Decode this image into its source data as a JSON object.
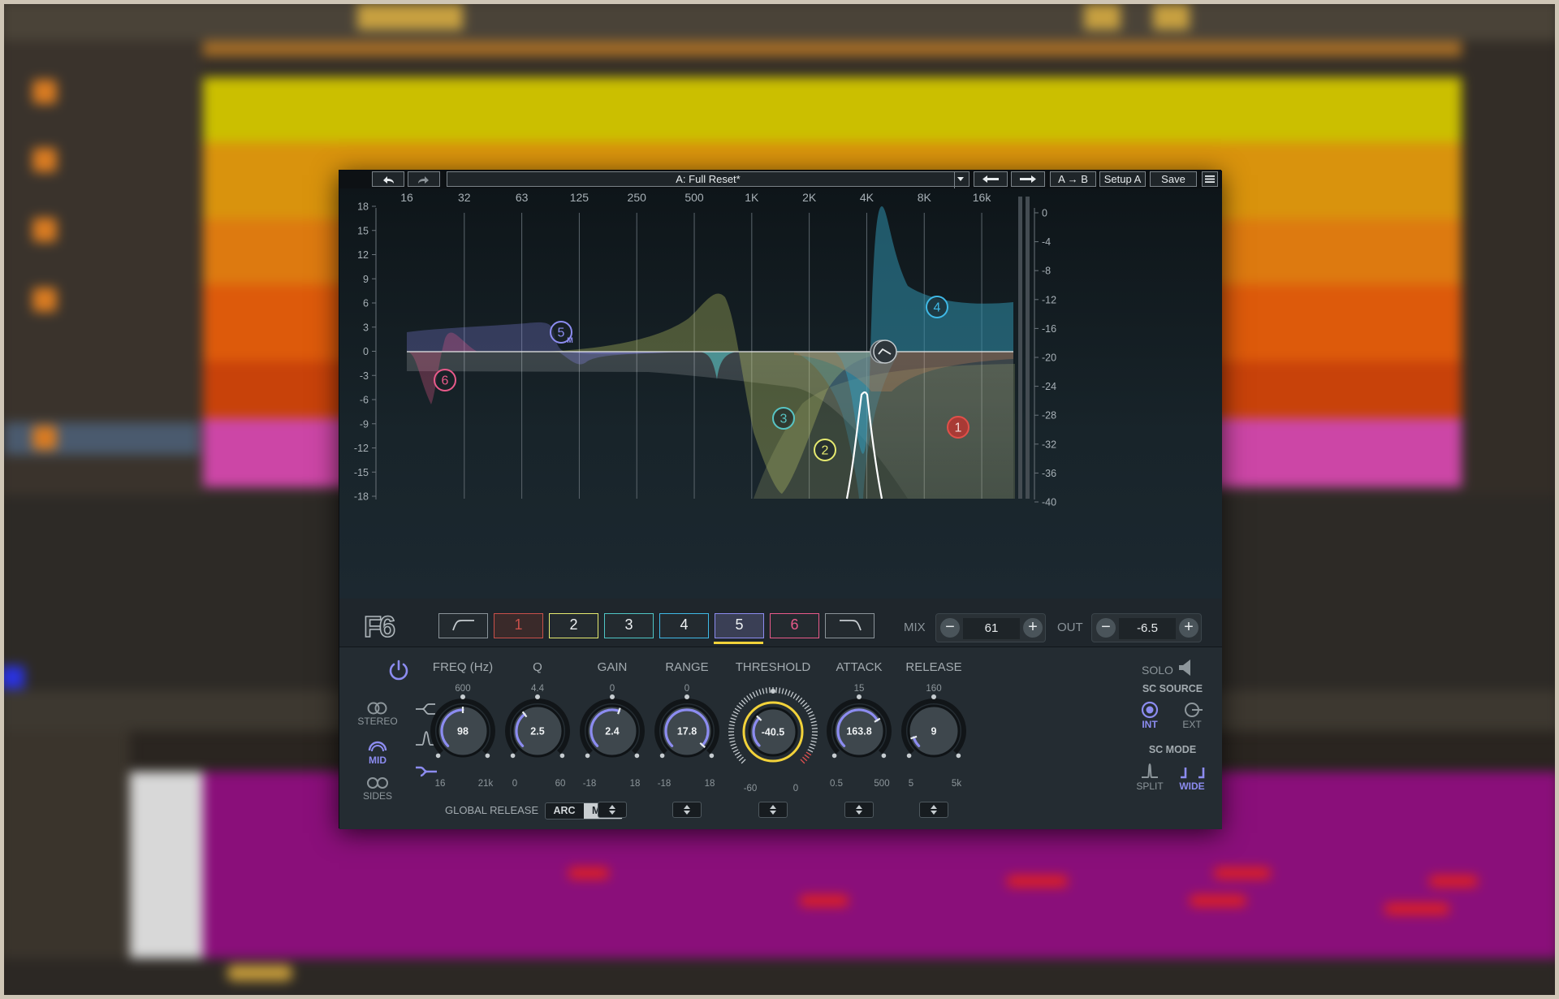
{
  "topbar": {
    "undo_icon": "undo-arrow-icon",
    "redo_icon": "redo-arrow-icon",
    "preset_name": "A: Full Reset*",
    "prev_icon": "left-arrow-icon",
    "next_icon": "right-arrow-icon",
    "ab_label": "A → B",
    "setup_label": "Setup A",
    "save_label": "Save",
    "menu_icon": "hamburger-menu-icon"
  },
  "graph": {
    "freq_labels": [
      "16",
      "32",
      "63",
      "125",
      "250",
      "500",
      "1K",
      "2K",
      "4K",
      "8K",
      "16k"
    ],
    "gain_labels": [
      "18",
      "15",
      "12",
      "9",
      "6",
      "3",
      "0",
      "-3",
      "-6",
      "-9",
      "-12",
      "-15",
      "-18"
    ],
    "dyn_labels": [
      "0",
      "-4",
      "-8",
      "-12",
      "-16",
      "-20",
      "-24",
      "-28",
      "-32",
      "-36",
      "-40"
    ],
    "band_nodes": [
      {
        "id": "1",
        "color": "#e0504a"
      },
      {
        "id": "2",
        "color": "#e6ea70"
      },
      {
        "id": "3",
        "color": "#58c4c4"
      },
      {
        "id": "4",
        "color": "#3fb9e6"
      },
      {
        "id": "5",
        "color": "#8c8cf0",
        "suffix": "M"
      },
      {
        "id": "6",
        "color": "#e85a8a"
      }
    ]
  },
  "bands": {
    "logo": "F6",
    "buttons": [
      {
        "label": "",
        "icon": "low-cut-icon",
        "color": "#8b949a"
      },
      {
        "label": "1",
        "color": "#c9504a"
      },
      {
        "label": "2",
        "color": "#e6ea70"
      },
      {
        "label": "3",
        "color": "#4fc6c6"
      },
      {
        "label": "4",
        "color": "#3fb9e6"
      },
      {
        "label": "5",
        "color": "#8c8cf0"
      },
      {
        "label": "6",
        "color": "#e85a8a"
      },
      {
        "label": "",
        "icon": "high-cut-icon",
        "color": "#8b949a"
      }
    ],
    "selected_band": "5",
    "mix_label": "MIX",
    "mix_value": "61",
    "out_label": "OUT",
    "out_value": "-6.5"
  },
  "controls": {
    "power_icon": "power-icon",
    "modes": [
      {
        "label": "STEREO",
        "icon": "stereo-rings-icon",
        "active": false
      },
      {
        "label": "MID",
        "icon": "mid-ring-icon",
        "active": true
      },
      {
        "label": "SIDES",
        "icon": "sides-rings-icon",
        "active": false
      }
    ],
    "shape_icons": [
      "shelf-shape-icon",
      "bell-shape-icon",
      "cut-shape-icon"
    ],
    "knobs": [
      {
        "label": "FREQ (Hz)",
        "value": "98",
        "top": "600",
        "min": "16",
        "max": "21k",
        "level": 0.5
      },
      {
        "label": "Q",
        "value": "2.5",
        "top": "4.4",
        "min": "0",
        "max": "60",
        "level": 0.36
      },
      {
        "label": "GAIN",
        "value": "2.4",
        "top": "0",
        "min": "-18",
        "max": "18",
        "level": 0.57
      },
      {
        "label": "RANGE",
        "value": "17.8",
        "top": "0",
        "min": "-18",
        "max": "18",
        "level": 0.99
      },
      {
        "label": "THRESHOLD",
        "value": "-40.5",
        "top": "",
        "min": "-60",
        "max": "0",
        "level": 0.33
      },
      {
        "label": "ATTACK",
        "value": "163.8",
        "top": "15",
        "min": "0.5",
        "max": "500",
        "level": 0.72
      },
      {
        "label": "RELEASE",
        "value": "9",
        "top": "160",
        "min": "5",
        "max": "5k",
        "level": 0.1
      }
    ],
    "solo_label": "SOLO",
    "solo_icon": "speaker-icon",
    "sc_source_label": "SC SOURCE",
    "int_label": "INT",
    "ext_label": "EXT",
    "sc_mode_label": "SC MODE",
    "split_label": "SPLIT",
    "wide_label": "WIDE",
    "global_release_label": "GLOBAL RELEASE",
    "arc_label": "ARC",
    "mnl_label": "MNL"
  },
  "colors": {
    "accent": "#8c8cf0",
    "threshold_ring": "#f2d23a"
  }
}
